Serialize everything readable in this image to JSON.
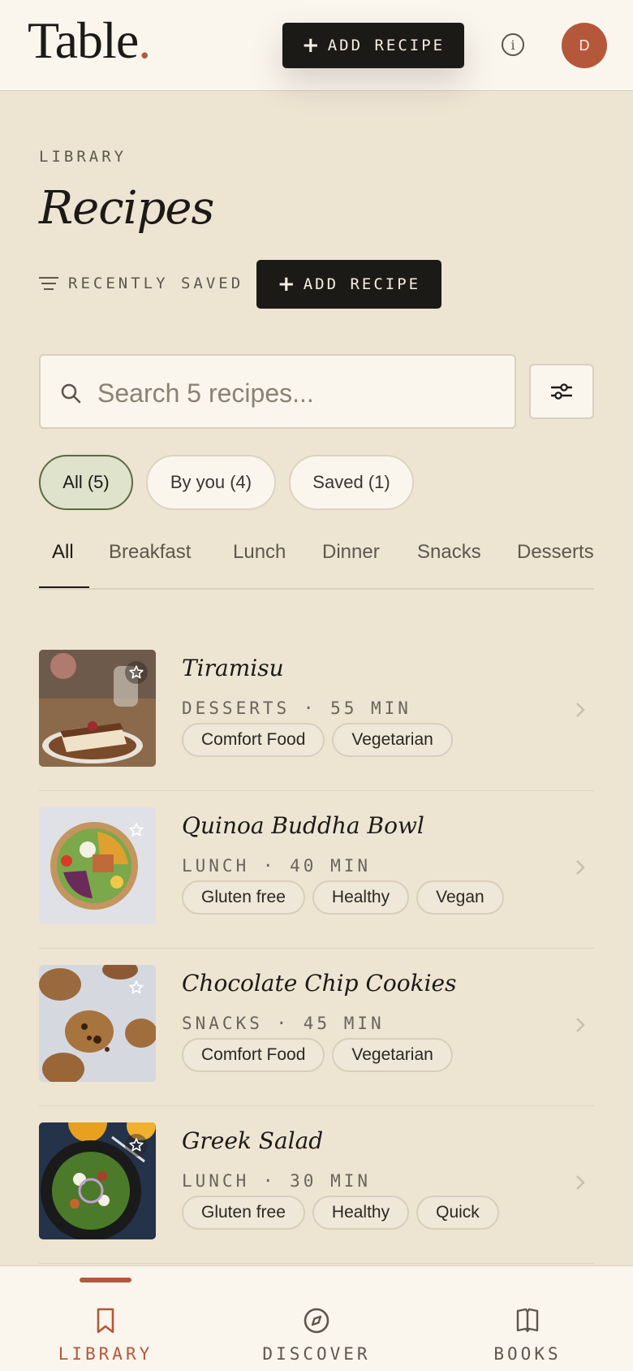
{
  "header": {
    "logo": "Table",
    "logo_dot": ".",
    "add_label": "ADD RECIPE",
    "info_icon": "info-icon",
    "avatar_initial": "D"
  },
  "page": {
    "eyebrow": "LIBRARY",
    "title": "Recipes",
    "sort_label": "RECENTLY SAVED",
    "add_label": "ADD RECIPE"
  },
  "search": {
    "placeholder": "Search 5 recipes..."
  },
  "filters": [
    {
      "label": "All (5)",
      "active": true
    },
    {
      "label": "By you (4)",
      "active": false
    },
    {
      "label": "Saved (1)",
      "active": false
    }
  ],
  "tabs": [
    "All",
    "Breakfast",
    "Lunch",
    "Dinner",
    "Snacks",
    "Desserts"
  ],
  "active_tab": "All",
  "recipes": [
    {
      "title": "Tiramisu",
      "meta": "DESSERTS · 55 MIN",
      "tags": [
        "Comfort Food",
        "Vegetarian"
      ]
    },
    {
      "title": "Quinoa Buddha Bowl",
      "meta": "LUNCH · 40 MIN",
      "tags": [
        "Gluten free",
        "Healthy",
        "Vegan"
      ]
    },
    {
      "title": "Chocolate Chip Cookies",
      "meta": "SNACKS · 45 MIN",
      "tags": [
        "Comfort Food",
        "Vegetarian"
      ]
    },
    {
      "title": "Greek Salad",
      "meta": "LUNCH · 30 MIN",
      "tags": [
        "Gluten free",
        "Healthy",
        "Quick"
      ]
    }
  ],
  "bottom_nav": [
    {
      "label": "LIBRARY",
      "icon": "bookmark-icon",
      "active": true
    },
    {
      "label": "DISCOVER",
      "icon": "compass-icon",
      "active": false
    },
    {
      "label": "BOOKS",
      "icon": "book-icon",
      "active": false
    }
  ],
  "colors": {
    "background": "#ede4d2",
    "surface": "#faf6ee",
    "ink": "#1c1a17",
    "accent": "#b5573a",
    "active_pill": "#dfe3cc"
  }
}
